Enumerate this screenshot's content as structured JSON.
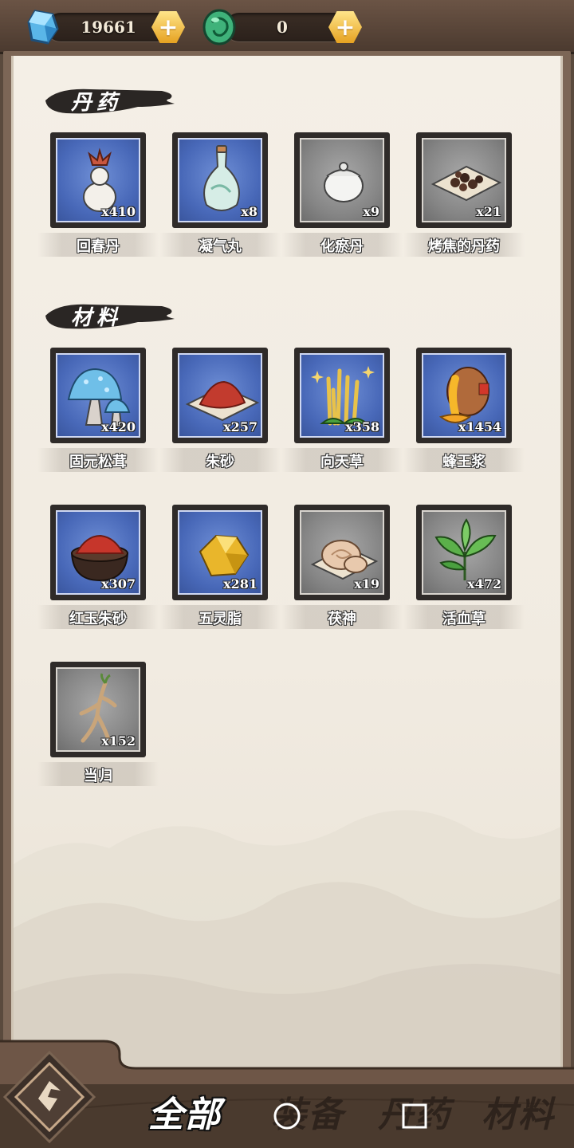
{
  "currency": {
    "spirit_stone": {
      "value": "19661",
      "icon": "blue-crystal-icon"
    },
    "jade": {
      "value": "0",
      "icon": "green-jade-icon"
    }
  },
  "sections": [
    {
      "title": "丹药",
      "items": [
        {
          "name": "回春丹",
          "qty": "x410",
          "bg": "blue",
          "icon": "gourd-bottle-icon"
        },
        {
          "name": "凝气丸",
          "qty": "x8",
          "bg": "blue",
          "icon": "porcelain-vase-icon"
        },
        {
          "name": "化瘀丹",
          "qty": "x9",
          "bg": "gray",
          "icon": "white-jar-icon"
        },
        {
          "name": "烤焦的丹药",
          "qty": "x21",
          "bg": "gray",
          "icon": "burnt-pills-icon"
        }
      ]
    },
    {
      "title": "材料",
      "items": [
        {
          "name": "固元松茸",
          "qty": "x420",
          "bg": "blue",
          "icon": "mushroom-icon"
        },
        {
          "name": "朱砂",
          "qty": "x257",
          "bg": "blue",
          "icon": "cinnabar-pile-icon"
        },
        {
          "name": "向天草",
          "qty": "x358",
          "bg": "blue",
          "icon": "golden-grass-icon"
        },
        {
          "name": "蜂王浆",
          "qty": "x1454",
          "bg": "blue",
          "icon": "honey-pot-icon"
        },
        {
          "name": "红玉朱砂",
          "qty": "x307",
          "bg": "blue",
          "icon": "red-powder-bowl-icon"
        },
        {
          "name": "五灵脂",
          "qty": "x281",
          "bg": "blue",
          "icon": "yellow-crystal-icon"
        },
        {
          "name": "茯神",
          "qty": "x19",
          "bg": "gray",
          "icon": "fungus-slices-icon"
        },
        {
          "name": "活血草",
          "qty": "x472",
          "bg": "gray",
          "icon": "green-herb-icon"
        },
        {
          "name": "当归",
          "qty": "x152",
          "bg": "gray",
          "icon": "root-icon"
        }
      ]
    }
  ],
  "tabs": [
    {
      "label": "全部",
      "active": true
    },
    {
      "label": "装备",
      "active": false
    },
    {
      "label": "丹药",
      "active": false
    },
    {
      "label": "材料",
      "active": false
    }
  ],
  "colors": {
    "frame_blue": "#4868b8",
    "frame_gray": "#858585",
    "parchment": "#f2ece2",
    "wood": "#6b5445",
    "plus_gold": "#f2b738"
  }
}
